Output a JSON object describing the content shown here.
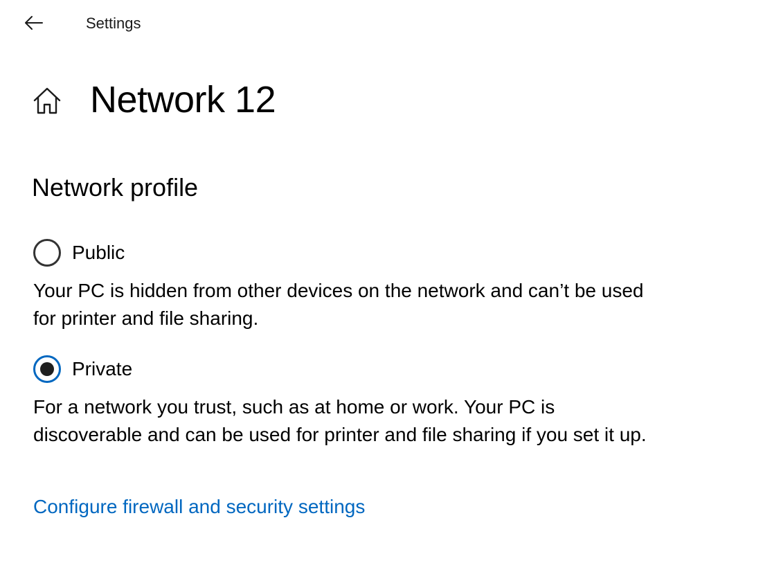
{
  "app": {
    "title": "Settings",
    "back_icon": "arrow-left-icon"
  },
  "page": {
    "home_icon": "home-icon",
    "title": "Network 12"
  },
  "network_profile": {
    "heading": "Network profile",
    "selected": "Private",
    "options": [
      {
        "label": "Public",
        "checked": false,
        "description": "Your PC is hidden from other devices on the network and can’t be used for printer and file sharing."
      },
      {
        "label": "Private",
        "checked": true,
        "description": "For a network you trust, such as at home or work. Your PC is discoverable and can be used for printer and file sharing if you set it up."
      }
    ]
  },
  "links": {
    "firewall": "Configure firewall and security settings"
  },
  "colors": {
    "accent": "#0067c0",
    "text": "#000000",
    "background": "#ffffff"
  }
}
